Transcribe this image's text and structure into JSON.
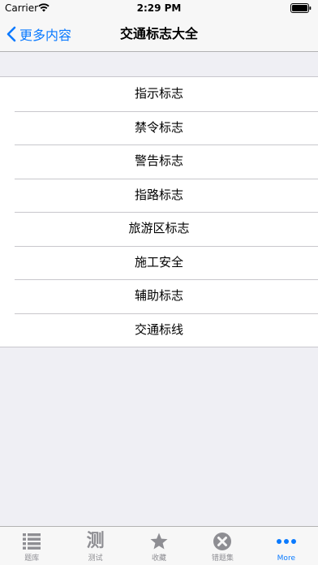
{
  "status_bar": {
    "carrier": "Carrier",
    "time": "2:29 PM"
  },
  "nav": {
    "back_label": "更多内容",
    "title": "交通标志大全"
  },
  "list": {
    "items": [
      "指示标志",
      "禁令标志",
      "警告标志",
      "指路标志",
      "旅游区标志",
      "施工安全",
      "辅助标志",
      "交通标线"
    ]
  },
  "tab_bar": {
    "items": [
      {
        "label": "题库",
        "icon": "list-icon"
      },
      {
        "label": "测试",
        "icon": "test-icon",
        "glyph": "测"
      },
      {
        "label": "收藏",
        "icon": "star-icon"
      },
      {
        "label": "错题集",
        "icon": "close-circle-icon"
      },
      {
        "label": "More",
        "icon": "more-icon",
        "active": true
      }
    ]
  },
  "colors": {
    "accent": "#0a7aff",
    "inactive": "#8e8e93",
    "background": "#efeff4"
  }
}
